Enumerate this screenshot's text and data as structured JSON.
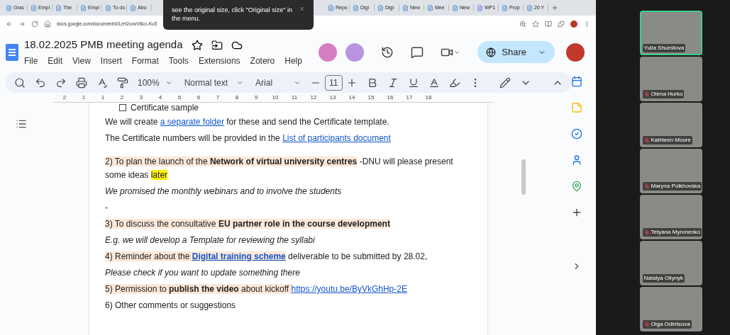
{
  "browser": {
    "tabs": [
      "Grac",
      "Empl",
      "The",
      "Empl",
      "To do",
      "Abo",
      "Repo",
      "Digi",
      "Digi",
      "New",
      "Mee",
      "New",
      "WP1",
      "Prop",
      "20 Y"
    ],
    "url": "docs.google.com/document/d/1zH2oovVBcc-Ku5"
  },
  "notice": {
    "text": "see the original size, click \"Original size\" in the menu."
  },
  "doc": {
    "title": "18.02.2025 PMB meeting agenda",
    "menu": [
      "File",
      "Edit",
      "View",
      "Insert",
      "Format",
      "Tools",
      "Extensions",
      "Zotero",
      "Help"
    ],
    "share": "Share",
    "zoom": "100%",
    "style": "Normal text",
    "font": "Arial",
    "size": "11",
    "ruler": [
      "2",
      "1",
      "1",
      "2",
      "3",
      "4",
      "5",
      "6",
      "7",
      "8",
      "9",
      "10",
      "11",
      "12",
      "13",
      "14",
      "15",
      "16",
      "17",
      "18"
    ],
    "checkbox": {
      "label": "Certificate sample",
      "checked": false
    },
    "paragraphs": [
      {
        "italic": false,
        "gap": false,
        "segments": [
          {
            "text": "We will create ",
            "kind": "plain",
            "shaded": false,
            "marked": false
          },
          {
            "text": "a separate folder",
            "kind": "link",
            "shaded": false,
            "marked": false
          },
          {
            "text": " for these and send the Certificate template.",
            "kind": "plain",
            "shaded": false,
            "marked": false
          }
        ]
      },
      {
        "italic": false,
        "gap": false,
        "segments": [
          {
            "text": "The Certificate numbers will be provided in the ",
            "kind": "plain",
            "shaded": false,
            "marked": false
          },
          {
            "text": "List of participants document",
            "kind": "link",
            "shaded": false,
            "marked": false
          }
        ]
      },
      {
        "italic": false,
        "gap": true,
        "segments": [
          {
            "text": "2) To plan the launch of the ",
            "kind": "plain",
            "shaded": true,
            "marked": false
          },
          {
            "text": "Network of virtual university centres",
            "kind": "bold",
            "shaded": true,
            "marked": false
          },
          {
            "text": " -DNU will please present some ideas ",
            "kind": "plain",
            "shaded": false,
            "marked": false
          },
          {
            "text": "later",
            "kind": "plain",
            "shaded": false,
            "marked": true
          }
        ]
      },
      {
        "italic": true,
        "gap": false,
        "segments": [
          {
            "text": "We promised the monthly webinars and to involve the students",
            "kind": "plain",
            "shaded": false,
            "marked": false
          }
        ]
      },
      {
        "italic": false,
        "gap": false,
        "segments": [
          {
            "text": "-",
            "kind": "plain",
            "shaded": false,
            "marked": false
          }
        ]
      },
      {
        "italic": false,
        "gap": false,
        "segments": [
          {
            "text": "3) To discuss the consultative  ",
            "kind": "plain",
            "shaded": true,
            "marked": false
          },
          {
            "text": "EU partner role in the course development",
            "kind": "bold",
            "shaded": true,
            "marked": false
          }
        ]
      },
      {
        "italic": true,
        "gap": false,
        "segments": [
          {
            "text": "E.g. we will develop a Template for reviewing the syllabi",
            "kind": "plain",
            "shaded": false,
            "marked": false
          }
        ]
      },
      {
        "italic": false,
        "gap": false,
        "segments": [
          {
            "text": "4) Reminder about the ",
            "kind": "plain",
            "shaded": true,
            "marked": false
          },
          {
            "text": "Digital training scheme",
            "kind": "boldlink",
            "shaded": true,
            "marked": false
          },
          {
            "text": " deliverable to be submitted by 28.02,",
            "kind": "plain",
            "shaded": false,
            "marked": false
          }
        ]
      },
      {
        "italic": true,
        "gap": false,
        "segments": [
          {
            "text": "Please check if you want to update something there",
            "kind": "plain",
            "shaded": false,
            "marked": false
          }
        ]
      },
      {
        "italic": false,
        "gap": false,
        "segments": [
          {
            "text": "5) Permission to ",
            "kind": "plain",
            "shaded": true,
            "marked": false
          },
          {
            "text": "publish the video",
            "kind": "bold",
            "shaded": true,
            "marked": false
          },
          {
            "text": " about kickoff ",
            "kind": "plain",
            "shaded": true,
            "marked": false
          },
          {
            "text": "https://youtu.be/ByVkGhHp-2E",
            "kind": "link",
            "shaded": false,
            "marked": false
          }
        ]
      },
      {
        "italic": false,
        "gap": false,
        "segments": [
          {
            "text": "6) Other comments or suggestions",
            "kind": "plain",
            "shaded": false,
            "marked": false
          }
        ]
      }
    ]
  },
  "participants": [
    {
      "name": "Yulia Shumilova",
      "muted": false,
      "speaking": true
    },
    {
      "name": "Olena Hurko",
      "muted": true,
      "speaking": false
    },
    {
      "name": "Kathleen Moore",
      "muted": true,
      "speaking": false
    },
    {
      "name": "Maryna Polkhovska",
      "muted": true,
      "speaking": false
    },
    {
      "name": "Tetyana Myronenko",
      "muted": true,
      "speaking": false
    },
    {
      "name": "Natalya Oliynyk",
      "muted": false,
      "speaking": false
    },
    {
      "name": "Olga Odintsova",
      "muted": true,
      "speaking": false
    }
  ]
}
